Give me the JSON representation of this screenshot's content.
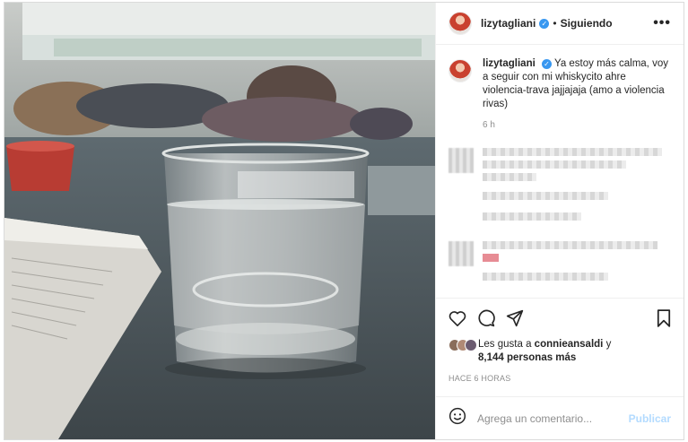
{
  "post": {
    "username": "lizytagliani",
    "verified_icon": "verified-badge-icon",
    "follow_dot": "•",
    "follow_status": "Siguiendo",
    "more_label": "•••",
    "caption_username": "lizytagliani",
    "caption_text": "Ya estoy más calma, voy a seguir con mi whiskycito ahre violencia-trava jajjajaja (amo a violencia rivas)",
    "caption_time": "6 h",
    "likes_prefix": "Les gusta a",
    "likes_user": "connieansaldi",
    "likes_and": "y",
    "likes_count": "8,144 personas más",
    "posted_ago": "HACE 6 HORAS"
  },
  "icons": {
    "like": "heart-icon",
    "comment": "comment-bubble-icon",
    "share": "paper-plane-icon",
    "save": "bookmark-icon",
    "emoji": "emoji-smile-icon"
  },
  "comment_box": {
    "placeholder": "Agrega un comentario...",
    "publish_label": "Publicar"
  },
  "colors": {
    "verified": "#3897f0",
    "publish_disabled": "#b3dbff",
    "muted_text": "#8e8e8e"
  }
}
